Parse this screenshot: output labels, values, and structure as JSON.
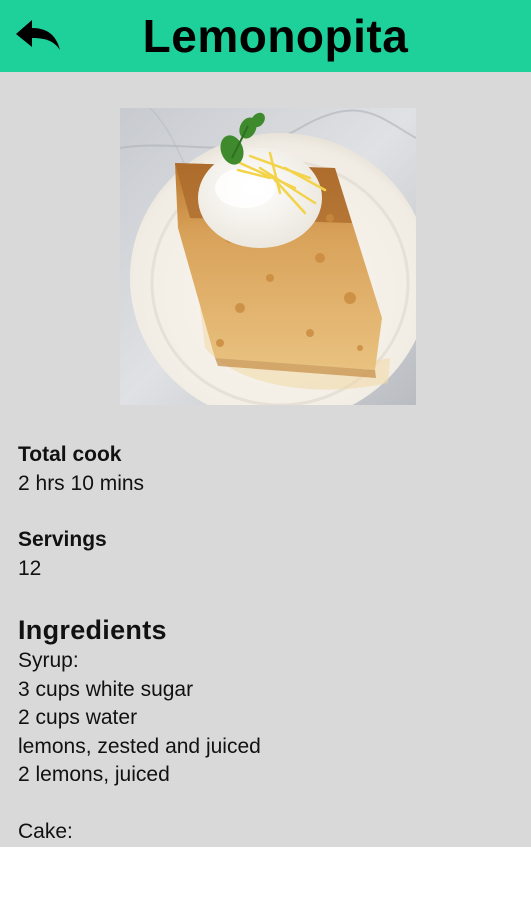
{
  "header": {
    "title": "Lemonopita",
    "back_icon": "back-arrow-icon",
    "background": "#1ed19a"
  },
  "recipe": {
    "image_alt": "Slice of lemon cake with whipped cream and lemon zest",
    "total_cook_label": "Total cook",
    "total_cook_value": "2 hrs 10 mins",
    "servings_label": "Servings",
    "servings_value": "12",
    "ingredients_heading": "Ingredients",
    "ingredients_group1": [
      "Syrup:",
      "3 cups white sugar",
      "2 cups water",
      "lemons, zested and juiced",
      "2 lemons, juiced"
    ],
    "ingredients_group2": [
      "Cake:"
    ]
  },
  "colors": {
    "page_background": "#d9d9d9",
    "header": "#1ed19a"
  }
}
